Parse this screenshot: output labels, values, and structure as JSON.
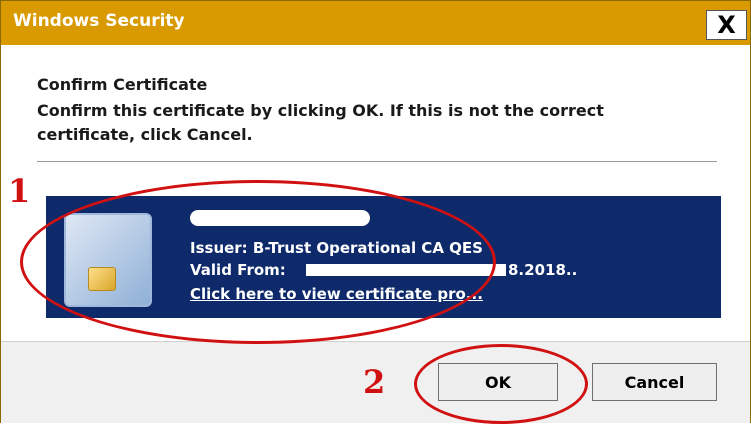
{
  "window": {
    "title": "Windows Security",
    "close_glyph": "X"
  },
  "dialog": {
    "heading": "Confirm Certificate",
    "message": "Confirm this certificate by clicking OK. If this is not the correct certificate, click Cancel."
  },
  "certificate": {
    "icon": "smart-card-icon",
    "issuer": "Issuer: B-Trust Operational CA QES",
    "valid_from_label": "Valid From:",
    "valid_from_tail": "8.2018..",
    "link_text": "Click here to view certificate pro..."
  },
  "buttons": {
    "ok": "OK",
    "cancel": "Cancel"
  },
  "annotations": {
    "one": "1",
    "two": "2",
    "color": "#d11111"
  },
  "colors": {
    "titlebar": "#d89a00",
    "cert_tile": "#0e2a6b"
  }
}
